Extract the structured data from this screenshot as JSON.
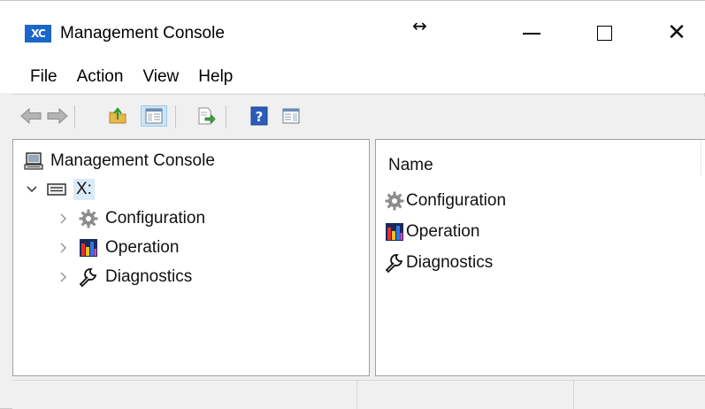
{
  "window": {
    "logo_text": "XC",
    "title": "Management Console",
    "resize_glyph": "↔",
    "close_glyph": "✕"
  },
  "menu": {
    "items": [
      {
        "label": "File"
      },
      {
        "label": "Action"
      },
      {
        "label": "View"
      },
      {
        "label": "Help"
      }
    ]
  },
  "toolbar": {
    "buttons": [
      "back-arrow-icon",
      "forward-arrow-icon",
      "up-folder-icon",
      "show-hide-tree-icon",
      "export-list-icon",
      "help-icon",
      "show-hide-action-pane-icon"
    ],
    "active_button": "show-hide-tree-icon"
  },
  "tree": {
    "root_label": "Management Console",
    "node_label": "X:",
    "children": [
      {
        "label": "Configuration",
        "icon": "gear-icon"
      },
      {
        "label": "Operation",
        "icon": "bar-chart-icon"
      },
      {
        "label": "Diagnostics",
        "icon": "wrench-icon"
      }
    ]
  },
  "list": {
    "column_header": "Name",
    "items": [
      {
        "label": "Configuration",
        "icon": "gear-icon"
      },
      {
        "label": "Operation",
        "icon": "bar-chart-icon"
      },
      {
        "label": "Diagnostics",
        "icon": "wrench-icon"
      }
    ]
  },
  "colors": {
    "logo_blue": "#1a66c9",
    "selection_bg": "#d9ebf9",
    "toolbar_active_bg": "#cce4f7"
  }
}
